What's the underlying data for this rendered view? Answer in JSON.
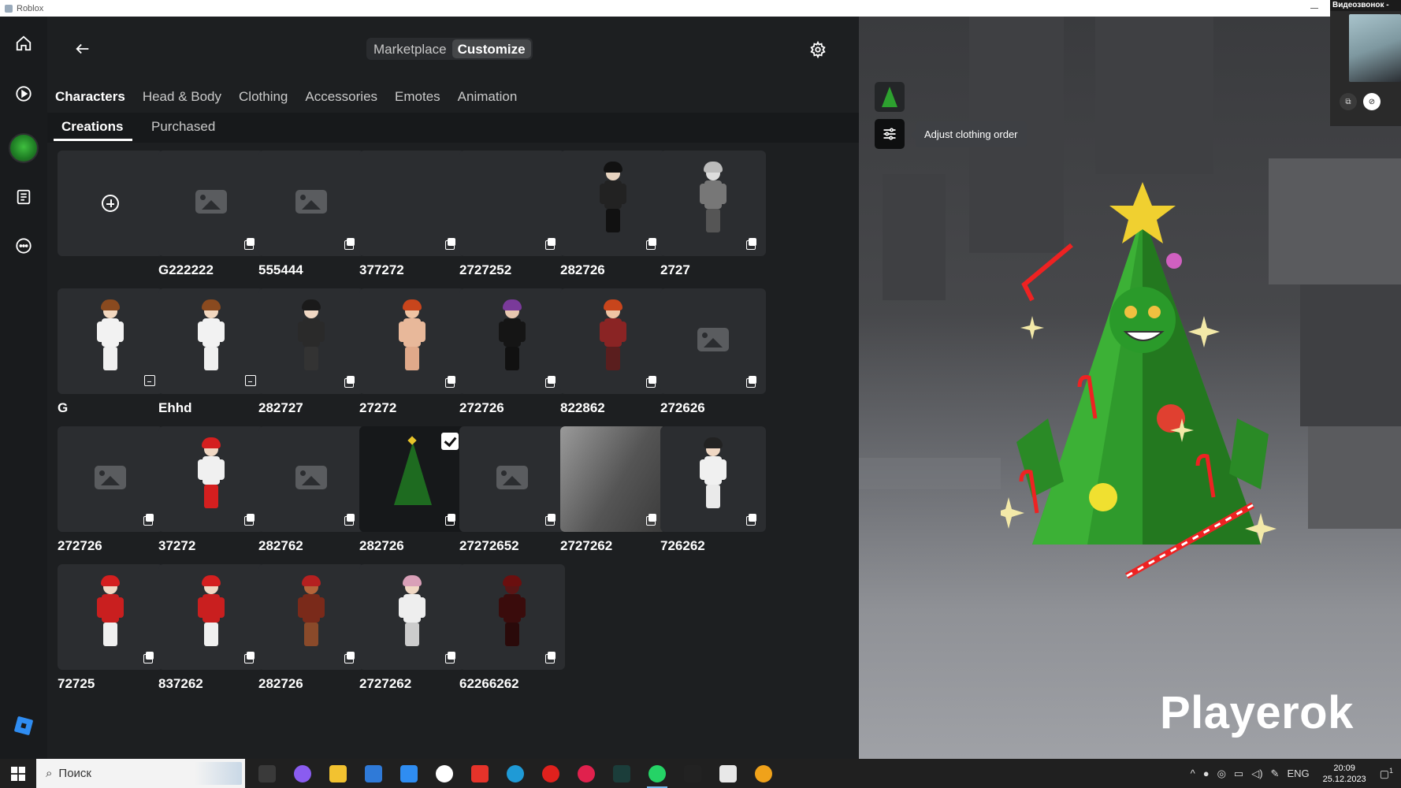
{
  "window": {
    "title": "Roblox"
  },
  "video_call": {
    "title": "Видеозвонок -"
  },
  "rail": {
    "items": [
      {
        "name": "home",
        "icon": "home-icon"
      },
      {
        "name": "play",
        "icon": "play-icon"
      },
      {
        "name": "avatar",
        "icon": "avatar-icon"
      },
      {
        "name": "notes",
        "icon": "notes-icon"
      },
      {
        "name": "more",
        "icon": "more-icon"
      }
    ]
  },
  "header": {
    "tabs": [
      {
        "label": "Marketplace",
        "active": false
      },
      {
        "label": "Customize",
        "active": true
      }
    ]
  },
  "categories": [
    "Characters",
    "Head & Body",
    "Clothing",
    "Accessories",
    "Emotes",
    "Animation"
  ],
  "subtabs": [
    "Creations",
    "Purchased"
  ],
  "characters": [
    {
      "label": "",
      "kind": "create"
    },
    {
      "label": "G222222",
      "kind": "placeholder"
    },
    {
      "label": "555444",
      "kind": "placeholder"
    },
    {
      "label": "377272",
      "kind": "empty"
    },
    {
      "label": "2727252",
      "kind": "empty"
    },
    {
      "label": "282726",
      "kind": "avatar",
      "hair": "#111",
      "body": "#222",
      "skin": "#e8d4c0",
      "legs": "#111"
    },
    {
      "label": "2727",
      "kind": "avatar",
      "hair": "#bbb",
      "body": "#777",
      "skin": "#ddd",
      "legs": "#555"
    },
    {
      "label": "G",
      "kind": "avatar",
      "badge": "outfit",
      "hair": "#8a4a1f",
      "body": "#f2f2f2",
      "skin": "#f2d8c0",
      "legs": "#f0f0f0"
    },
    {
      "label": "Ehhd",
      "kind": "avatar",
      "badge": "outfit",
      "hair": "#8a4a1f",
      "body": "#f2f2f2",
      "skin": "#f2d8c0",
      "legs": "#f0f0f0"
    },
    {
      "label": "282727",
      "kind": "avatar",
      "hair": "#1a1a1a",
      "body": "#2a2a2a",
      "skin": "#f0d8c4",
      "legs": "#333"
    },
    {
      "label": "27272",
      "kind": "avatar",
      "hair": "#c8451c",
      "body": "#e8b89a",
      "skin": "#efc4a4",
      "legs": "#e0a98a"
    },
    {
      "label": "272726",
      "kind": "avatar",
      "hair": "#7a3a9a",
      "body": "#151515",
      "skin": "#e8c8b0",
      "legs": "#111"
    },
    {
      "label": "822862",
      "kind": "avatar",
      "hair": "#c8451c",
      "body": "#8a2424",
      "skin": "#efc4a4",
      "legs": "#5a1e1e"
    },
    {
      "label": "272626",
      "kind": "placeholder"
    },
    {
      "label": "272726",
      "kind": "placeholder"
    },
    {
      "label": "37272",
      "kind": "avatar",
      "hair": "#d41f1f",
      "body": "#f0f0f0",
      "skin": "#f0d8c4",
      "legs": "#d41f1f"
    },
    {
      "label": "282762",
      "kind": "placeholder"
    },
    {
      "label": "282726",
      "kind": "tree",
      "selected": true
    },
    {
      "label": "27272652",
      "kind": "placeholder"
    },
    {
      "label": "2727262",
      "kind": "gradient"
    },
    {
      "label": "726262",
      "kind": "avatar",
      "hair": "#222",
      "body": "#f0f0f0",
      "skin": "#f0d8c4",
      "legs": "#eaeaea"
    },
    {
      "label": "72725",
      "kind": "avatar",
      "hair": "#d41f1f",
      "body": "#c91f1f",
      "skin": "#f0d8c4",
      "legs": "#f0f0f0"
    },
    {
      "label": "837262",
      "kind": "avatar",
      "hair": "#d41f1f",
      "body": "#c91f1f",
      "skin": "#f0d8c4",
      "legs": "#f0f0f0"
    },
    {
      "label": "282726",
      "kind": "avatar",
      "hair": "#b52020",
      "body": "#7a2a1a",
      "skin": "#b4643a",
      "legs": "#8a4a2a"
    },
    {
      "label": "2727262",
      "kind": "avatar",
      "hair": "#d9a0b8",
      "body": "#eee",
      "skin": "#f0d8c4",
      "legs": "#ccc"
    },
    {
      "label": "62266262",
      "kind": "avatar",
      "hair": "#6a0f0f",
      "body": "#3a0c0c",
      "skin": "#5a1515",
      "legs": "#2a0a0a"
    }
  ],
  "preview": {
    "tooltip": "Adjust clothing order",
    "watermark": "Playerok"
  },
  "taskbar": {
    "search_placeholder": "Поиск",
    "language": "ENG",
    "time": "20:09",
    "date": "25.12.2023",
    "notification_count": "1",
    "apps": [
      {
        "name": "task-view",
        "color": "#3a3a3a"
      },
      {
        "name": "cortana",
        "color": "#8a5cf0"
      },
      {
        "name": "file-explorer",
        "color": "#f2c230"
      },
      {
        "name": "store",
        "color": "#2f7ad8"
      },
      {
        "name": "mail",
        "color": "#2f8df2"
      },
      {
        "name": "yandex-browser",
        "color": "#ffffff"
      },
      {
        "name": "yandex",
        "color": "#e6332a"
      },
      {
        "name": "edge",
        "color": "#1f9ad6"
      },
      {
        "name": "opera",
        "color": "#e0211d"
      },
      {
        "name": "opera-gx",
        "color": "#e0214d"
      },
      {
        "name": "terminal",
        "color": "#1b3d3a"
      },
      {
        "name": "whatsapp",
        "color": "#25d366"
      },
      {
        "name": "app-dark",
        "color": "#222"
      },
      {
        "name": "roblox",
        "color": "#e8e8e8"
      },
      {
        "name": "pinned-app",
        "color": "#f0a21a"
      }
    ]
  },
  "colors": {
    "panel_bg": "#1d1f21",
    "tile_bg": "#2b2d30",
    "accent": "#ffffff"
  }
}
